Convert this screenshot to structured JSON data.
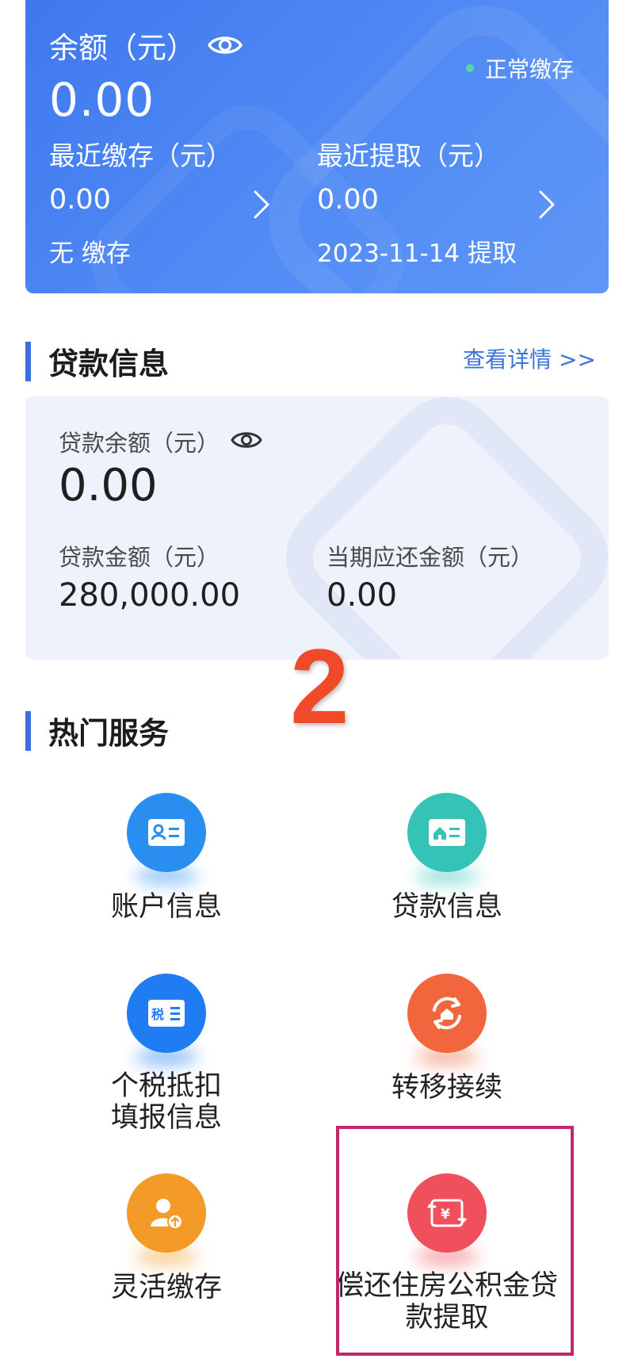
{
  "account": {
    "balance_label": "余额（元）",
    "balance_value": "0.00",
    "status": "正常缴存",
    "recent_deposit_label": "最近缴存（元）",
    "recent_deposit_value": "0.00",
    "recent_deposit_note": "无 缴存",
    "recent_withdraw_label": "最近提取（元）",
    "recent_withdraw_value": "0.00",
    "recent_withdraw_note": "2023-11-14 提取",
    "status_color": "#56d99a"
  },
  "loan": {
    "section_title": "贷款信息",
    "details_link": "查看详情 >>",
    "balance_label": "贷款余额（元）",
    "balance_value": "0.00",
    "amount_label": "贷款金额（元）",
    "amount_value": "280,000.00",
    "due_label": "当期应还金额（元）",
    "due_value": "0.00"
  },
  "annotation": {
    "step_number": "2"
  },
  "services": {
    "section_title": "热门服务",
    "items": [
      {
        "label": "账户信息",
        "icon": "id-card-icon",
        "color": "#2a8ef0"
      },
      {
        "label": "贷款信息",
        "icon": "house-card-icon",
        "color": "#35c3b8"
      },
      {
        "label": "个税抵扣填报信息",
        "icon": "tax-card-icon",
        "color": "#1f7cf2"
      },
      {
        "label": "转移接续",
        "icon": "transfer-cycle-icon",
        "color": "#f2663d"
      },
      {
        "label": "灵活缴存",
        "icon": "user-upload-icon",
        "color": "#f39a28"
      },
      {
        "label": "偿还住房公积金贷款提取",
        "icon": "yuan-repay-icon",
        "color": "#f04f5c"
      }
    ]
  }
}
